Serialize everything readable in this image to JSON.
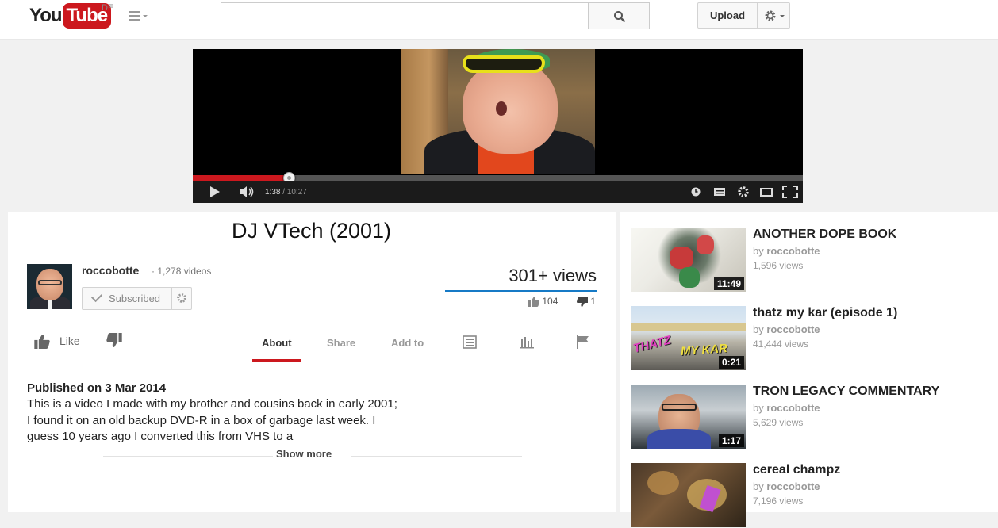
{
  "header": {
    "logo_you": "You",
    "logo_tube": "Tube",
    "region": "DE",
    "search_placeholder": "",
    "upload_label": "Upload"
  },
  "player": {
    "current_time": "1:38",
    "separator": " / ",
    "duration": "10:27",
    "progress_fraction": 0.157
  },
  "video": {
    "title": "DJ VTech (2001)",
    "channel_name": "roccobotte",
    "channel_video_count": "1,278 videos",
    "subscribe_label": "Subscribed",
    "views": "301+ views",
    "likes": "104",
    "dislikes": "1",
    "like_label": "Like",
    "published": "Published on 3 Mar 2014",
    "description": "This is a video I made with my brother and cousins back in early 2001; I found it on an old backup DVD-R in a box of garbage last week. I guess 10 years ago I converted this from VHS to a",
    "show_more": "Show more"
  },
  "tabs": [
    {
      "label": "About",
      "active": true
    },
    {
      "label": "Share",
      "active": false
    },
    {
      "label": "Add to",
      "active": false
    }
  ],
  "related": [
    {
      "title": "ANOTHER DOPE BOOK",
      "by_prefix": "by",
      "channel": "roccobotte",
      "views": "1,596 views",
      "duration": "11:49"
    },
    {
      "title": "thatz my kar (episode 1)",
      "by_prefix": "by",
      "channel": "roccobotte",
      "views": "41,444 views",
      "duration": "0:21",
      "thumb_text_1": "THATZ",
      "thumb_text_2": "MY KAR"
    },
    {
      "title": "TRON LEGACY COMMENTARY",
      "by_prefix": "by",
      "channel": "roccobotte",
      "views": "5,629 views",
      "duration": "1:17"
    },
    {
      "title": "cereal champz",
      "by_prefix": "by",
      "channel": "roccobotte",
      "views": "7,196 views",
      "duration": ""
    }
  ],
  "colors": {
    "brand_red": "#cc181e",
    "link_blue": "#167ac6"
  }
}
